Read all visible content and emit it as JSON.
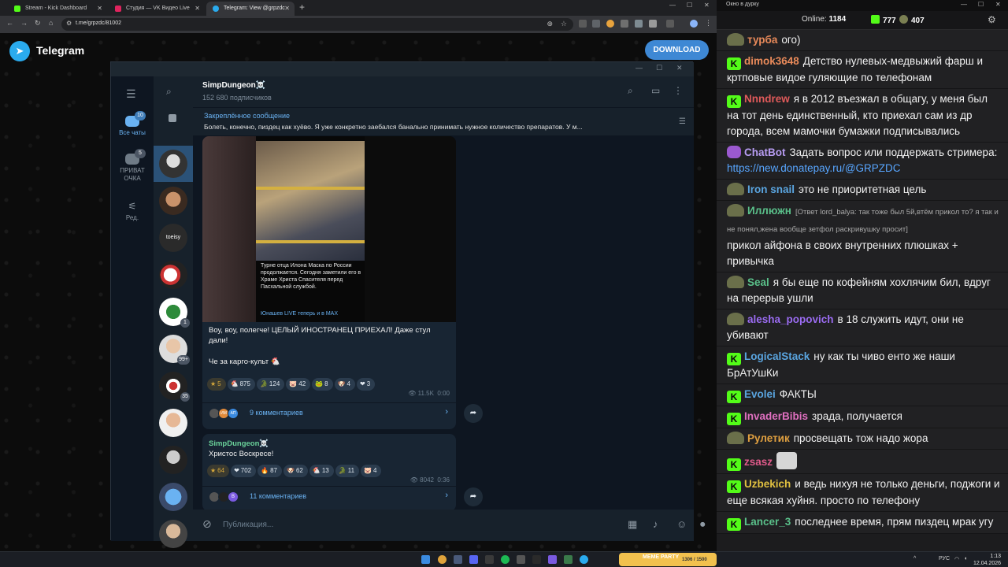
{
  "browser": {
    "tabs": [
      {
        "label": "Stream - Kick Dashboard",
        "color": "#53fc18"
      },
      {
        "label": "Студия — VK Видео Live",
        "color": "#e0245e"
      },
      {
        "label": "Telegram: View @grpzdc",
        "color": "#2aabee"
      }
    ],
    "url": "t.me/grpzdc/81002"
  },
  "tgweb": {
    "brand": "Telegram",
    "download_label": "DOWNLOAD"
  },
  "tgapp": {
    "folders": [
      {
        "label": "Все чаты",
        "badge": "10"
      },
      {
        "label": "ПРИВАТ ОЧКА",
        "badge": "5"
      },
      {
        "label": "Ред.",
        "badge": ""
      }
    ],
    "chat_badges": [
      "1",
      "99+",
      "35"
    ],
    "chat_avatar_text": "toeisy",
    "channel": {
      "title": "SimpDungeon☠️",
      "subscribers": "152 680 подписчиков"
    },
    "pinned": {
      "label": "Закреплённое сообщение",
      "text": "Болеть, конечно, пиздец как хуёво. Я уже конкретно заебался банально принимать нужное количество препаратов. У м..."
    },
    "post1": {
      "caption": "Турне отца Илона Маска по России продолжается. Сегодня заметили его в Храме Христа Спасителя перед Пасхальной службой.",
      "caption_source": "Юнашев LIVE теперь и в MAX",
      "text1": "Воу, воу, полегче! ЦЕЛЫЙ ИНОСТРАНЕЦ ПРИЕХАЛ! Даже стул дали!",
      "text2": "Че за карго-культ 🐔",
      "reactions": [
        {
          "emoji": "★",
          "count": "5",
          "gold": true
        },
        {
          "emoji": "🐔",
          "count": "875"
        },
        {
          "emoji": "🐊",
          "count": "124"
        },
        {
          "emoji": "🐷",
          "count": "42"
        },
        {
          "emoji": "🐸",
          "count": "8"
        },
        {
          "emoji": "🐶",
          "count": "4"
        },
        {
          "emoji": "❤",
          "count": "3"
        }
      ],
      "views": "11.5K",
      "time": "0:00",
      "comment_avatars": [
        "ИМ",
        "АП"
      ],
      "comments": "9 комментариев"
    },
    "post2": {
      "author": "SimpDungeon☠️",
      "text": "Христос Воскресе!",
      "reactions": [
        {
          "emoji": "★",
          "count": "64",
          "gold": true
        },
        {
          "emoji": "❤",
          "count": "702"
        },
        {
          "emoji": "🔥",
          "count": "87"
        },
        {
          "emoji": "🐶",
          "count": "62"
        },
        {
          "emoji": "🐔",
          "count": "13"
        },
        {
          "emoji": "🐊",
          "count": "11"
        },
        {
          "emoji": "🐷",
          "count": "4"
        }
      ],
      "views": "8042",
      "time": "0:36",
      "comment_avatars": [
        "В"
      ],
      "comments": "11 комментариев"
    },
    "composer_placeholder": "Публикация..."
  },
  "chatwin": {
    "title": "Окно в дурку",
    "online_label": "Online:",
    "online_count": "1184",
    "kick_count": "777",
    "twitch_count": "407",
    "messages": [
      {
        "badge": "tw",
        "nick": "турба",
        "color": "#e98a5a",
        "text": "ого)"
      },
      {
        "badge": "k",
        "nick": "dimok3648",
        "color": "#e98a5a",
        "text": "Детство нулевых-медвыжий фарш и кртповые видое гуляющие по телефонам"
      },
      {
        "badge": "k",
        "nick": "Nnndrew",
        "color": "#e05a5a",
        "text": "я в 2012 въезжал в общагу, у меня был на тот день единственный, кто приехал сам из др города, всем мамочки бумажки подписывались"
      },
      {
        "badge": "bot",
        "nick": "ChatBot",
        "color": "#b79cf2",
        "text": "Задать вопрос или поддержать стримера:",
        "link": "https://new.donatepay.ru/@GRPZDC"
      },
      {
        "badge": "tw",
        "nick": "Iron snail",
        "color": "#5aa5e0",
        "text": "это не приоритетная цель"
      },
      {
        "badge": "tw",
        "nick": "Иллюжн",
        "color": "#5ac08a",
        "reply": "[Ответ lord_balya: так тоже был 5й,втём прикол то? я так и не понял,жена вообще зетфол раскривушку просит]",
        "text": "прикол айфона в своих внутренних плюшках + привычка"
      },
      {
        "badge": "tw",
        "nick": "Seal",
        "color": "#5ac08a",
        "text": "я бы еще по кофейням хохлячим бил, вдруг на перерыв ушли"
      },
      {
        "badge": "tw",
        "nick": "alesha_popovich",
        "color": "#9b6cf2",
        "text": "в 18 служить идут, они не убивают"
      },
      {
        "badge": "k",
        "nick": "LogicalStack",
        "color": "#5aa5e0",
        "text": "ну как ты чиво енто же наши БрАтУшКи"
      },
      {
        "badge": "k",
        "nick": "Evolei",
        "color": "#5aa5e0",
        "text": "ФАКТЫ"
      },
      {
        "badge": "k",
        "nick": "InvaderBibis",
        "color": "#e070c0",
        "text": "зрада, получается"
      },
      {
        "badge": "tw",
        "nick": "Рулетик",
        "color": "#e0a040",
        "text": "просвещать тож надо жора"
      },
      {
        "badge": "k",
        "nick": "zsasz",
        "color": "#e05a8a",
        "text": "",
        "emote": true
      },
      {
        "badge": "k",
        "nick": "Uzbekich",
        "color": "#e0c040",
        "text": "и ведь нихуя не только деньги, поджоги и еще всякая хуйня. просто по телефону"
      },
      {
        "badge": "k",
        "nick": "Lancer_3",
        "color": "#5ac08a",
        "text": "последнее время, прям пиздец мрак угу"
      }
    ]
  },
  "taskbar": {
    "meme_label": "MEME PARTY",
    "meme_sub": "1306 / 1500",
    "lang": "РУС",
    "time": "1:13",
    "date": "12.04.2026"
  }
}
